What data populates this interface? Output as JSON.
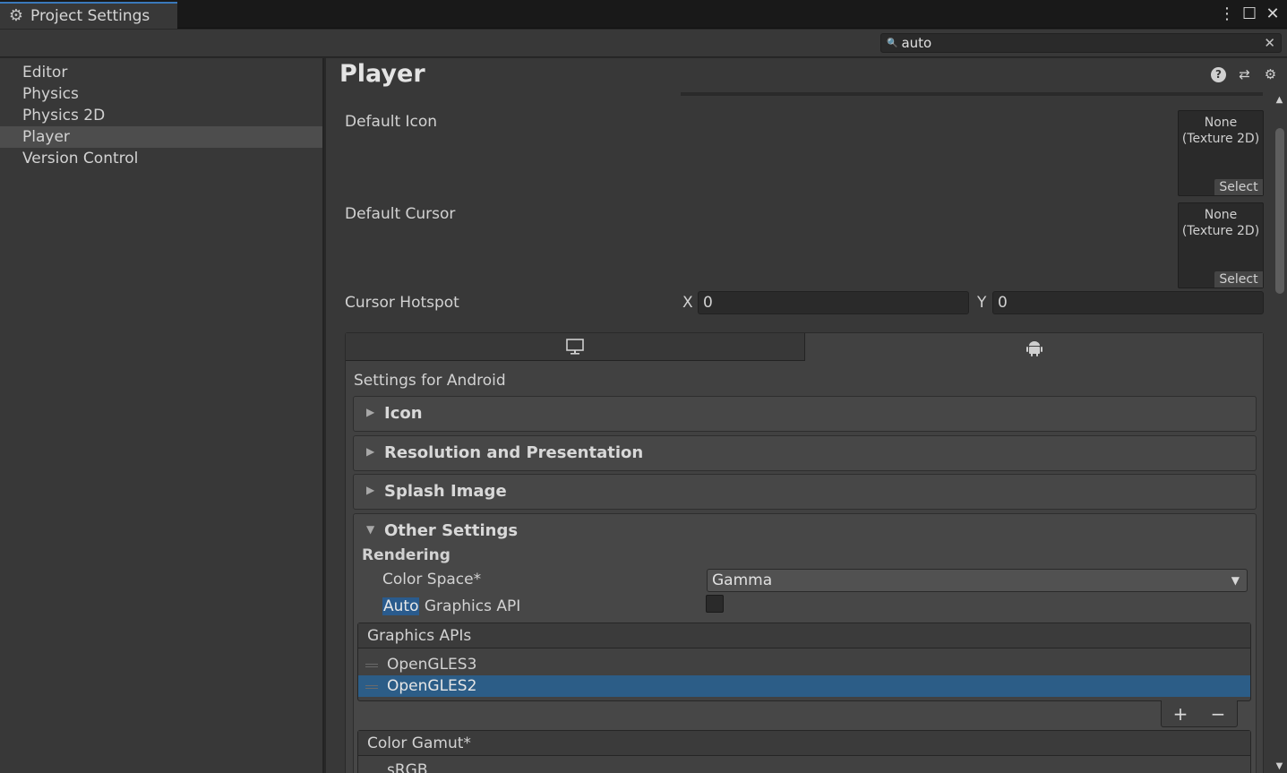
{
  "window": {
    "tab_title": "Project Settings",
    "tab_icon": "gear-icon",
    "controls": [
      "more-icon",
      "maximize-icon",
      "close-icon"
    ]
  },
  "search": {
    "value": "auto",
    "icon": "search-icon",
    "clear_icon": "clear-icon"
  },
  "sidebar": {
    "items": [
      {
        "label": "Editor"
      },
      {
        "label": "Physics"
      },
      {
        "label": "Physics 2D"
      },
      {
        "label": "Player"
      },
      {
        "label": "Version Control"
      }
    ],
    "selected": "Player"
  },
  "main": {
    "title": "Player",
    "title_icons": [
      "help-icon",
      "preset-icon",
      "settings-icon"
    ],
    "default_icon": {
      "label": "Default Icon",
      "value_line1": "None",
      "value_line2": "(Texture 2D)",
      "select": "Select"
    },
    "default_cursor": {
      "label": "Default Cursor",
      "value_line1": "None",
      "value_line2": "(Texture 2D)",
      "select": "Select"
    },
    "cursor_hotspot": {
      "label": "Cursor Hotspot",
      "x_label": "X",
      "x_value": "0",
      "y_label": "Y",
      "y_value": "0"
    },
    "platform_tabs": [
      {
        "icon": "desktop-icon",
        "selected": false
      },
      {
        "icon": "android-icon",
        "selected": true
      }
    ],
    "settings_for": "Settings for Android",
    "foldouts": [
      {
        "label": "Icon",
        "open": false
      },
      {
        "label": "Resolution and Presentation",
        "open": false
      },
      {
        "label": "Splash Image",
        "open": false
      },
      {
        "label": "Other Settings",
        "open": true
      }
    ],
    "rendering": {
      "heading": "Rendering",
      "color_space_label": "Color Space*",
      "color_space_value": "Gamma",
      "auto_graphics_highlight": "Auto",
      "auto_graphics_rest": " Graphics API",
      "auto_graphics_checked": false
    },
    "graphics_apis": {
      "header": "Graphics APIs",
      "items": [
        "OpenGLES3",
        "OpenGLES2"
      ],
      "selected_index": 1,
      "add": "+",
      "remove": "−"
    },
    "color_gamut": {
      "header": "Color Gamut*",
      "items": [
        "sRGB"
      ]
    }
  }
}
